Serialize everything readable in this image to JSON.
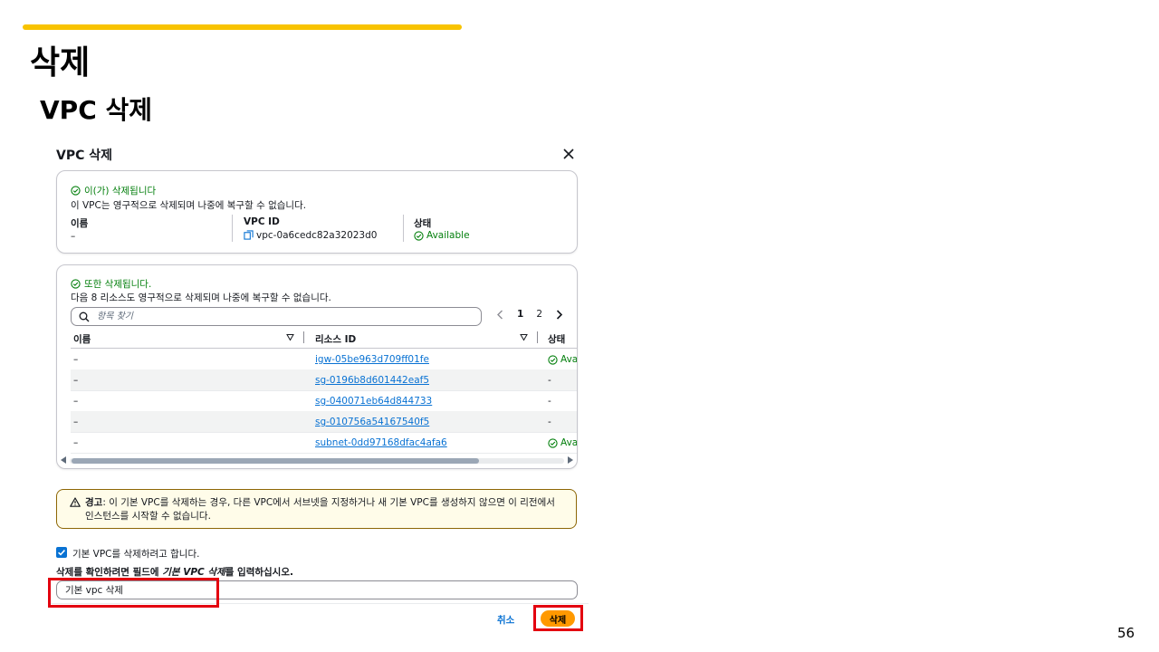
{
  "slide": {
    "title": "삭제",
    "subtitle": "VPC 삭제",
    "page_number": "56",
    "accent_color": "#f8c300"
  },
  "modal": {
    "title": "VPC 삭제",
    "vpc_panel": {
      "deleted_label": "이(가) 삭제됩니다",
      "description": "이 VPC는 영구적으로 삭제되며 나중에 복구할 수 없습니다.",
      "name_label": "이름",
      "name_value": "–",
      "id_label": "VPC ID",
      "id_value": "vpc-0a6cedc82a32023d0",
      "state_label": "상태",
      "state_value": "Available"
    },
    "resources_panel": {
      "deleted_label": "또한 삭제됩니다.",
      "description": "다음 8 리소스도 영구적으로 삭제되며 나중에 복구할 수 없습니다.",
      "search_placeholder": "항목 찾기",
      "pagination": {
        "current": "1",
        "next": "2"
      },
      "columns": {
        "name": "이름",
        "resource_id": "리소스 ID",
        "status": "상태"
      },
      "rows": [
        {
          "name": "–",
          "resource_id": "igw-05be963d709ff01fe",
          "status": "Ava"
        },
        {
          "name": "–",
          "resource_id": "sg-0196b8d601442eaf5",
          "status": "-"
        },
        {
          "name": "–",
          "resource_id": "sg-040071eb64d844733",
          "status": "-"
        },
        {
          "name": "–",
          "resource_id": "sg-010756a54167540f5",
          "status": "-"
        },
        {
          "name": "–",
          "resource_id": "subnet-0dd97168dfac4afa6",
          "status": "Ava"
        }
      ]
    },
    "warning": {
      "label": "경고",
      "text": ": 이 기본 VPC를 삭제하는 경우, 다른 VPC에서 서브넷을 지정하거나 새 기본 VPC를 생성하지 않으면 이 리전에서 인스턴스를 시작할 수 없습니다."
    },
    "checkbox_label": "기본 VPC를 삭제하려고 합니다.",
    "confirm": {
      "prefix": "삭제를 확인하려면 필드에 ",
      "keyword": "기본 VPC 삭제",
      "suffix": "를 입력하십시오.",
      "input_value": "기본 vpc 삭제"
    },
    "buttons": {
      "cancel": "취소",
      "delete": "삭제"
    },
    "colors": {
      "success": "#037f0c",
      "link": "#0972d3",
      "primary_button": "#ff9900",
      "highlight_box": "#e3000f"
    }
  }
}
